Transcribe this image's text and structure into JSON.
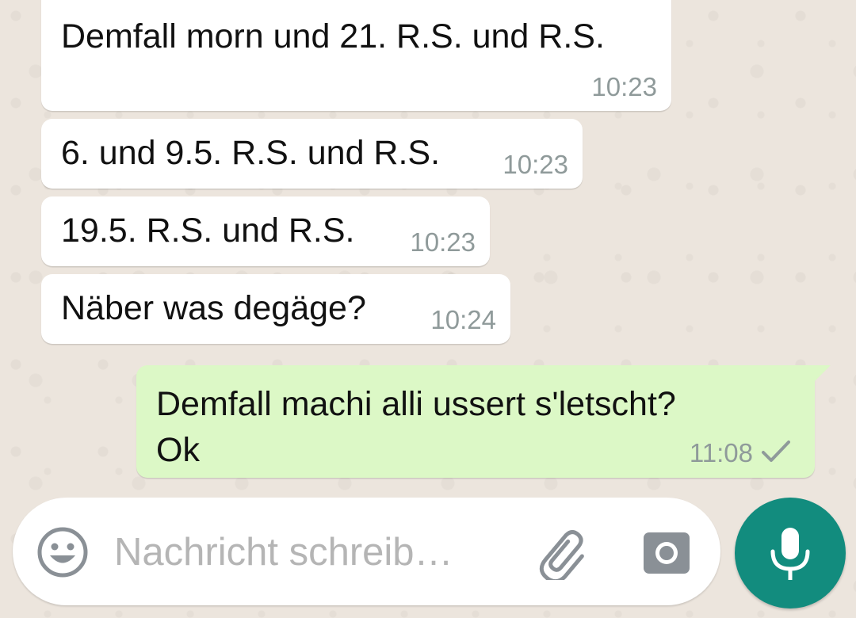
{
  "messages": [
    {
      "direction": "incoming",
      "text": "Demfall morn und 21. R.S. und R.S.",
      "time": "10:23"
    },
    {
      "direction": "incoming",
      "text": "6. und 9.5. R.S. und R.S.",
      "time": "10:23"
    },
    {
      "direction": "incoming",
      "text": "19.5. R.S. und R.S.",
      "time": "10:23"
    },
    {
      "direction": "incoming",
      "text": "Näber was degäge?",
      "time": "10:24"
    },
    {
      "direction": "outgoing",
      "text": "Demfall machi alli ussert s'letscht?\nOk",
      "time": "11:08",
      "status_icon": "single-check-icon"
    }
  ],
  "composer": {
    "placeholder": "Nachricht schreib…",
    "value": "",
    "emoji_icon": "emoji-icon",
    "attach_icon": "paperclip-icon",
    "camera_icon": "camera-icon",
    "mic_icon": "microphone-icon"
  },
  "colors": {
    "chat_background": "#ece5dd",
    "incoming_bubble": "#ffffff",
    "outgoing_bubble": "#dcf8c6",
    "timestamp": "#8f9a9a",
    "accent": "#128c7e",
    "icon_gray": "#8a9096"
  }
}
